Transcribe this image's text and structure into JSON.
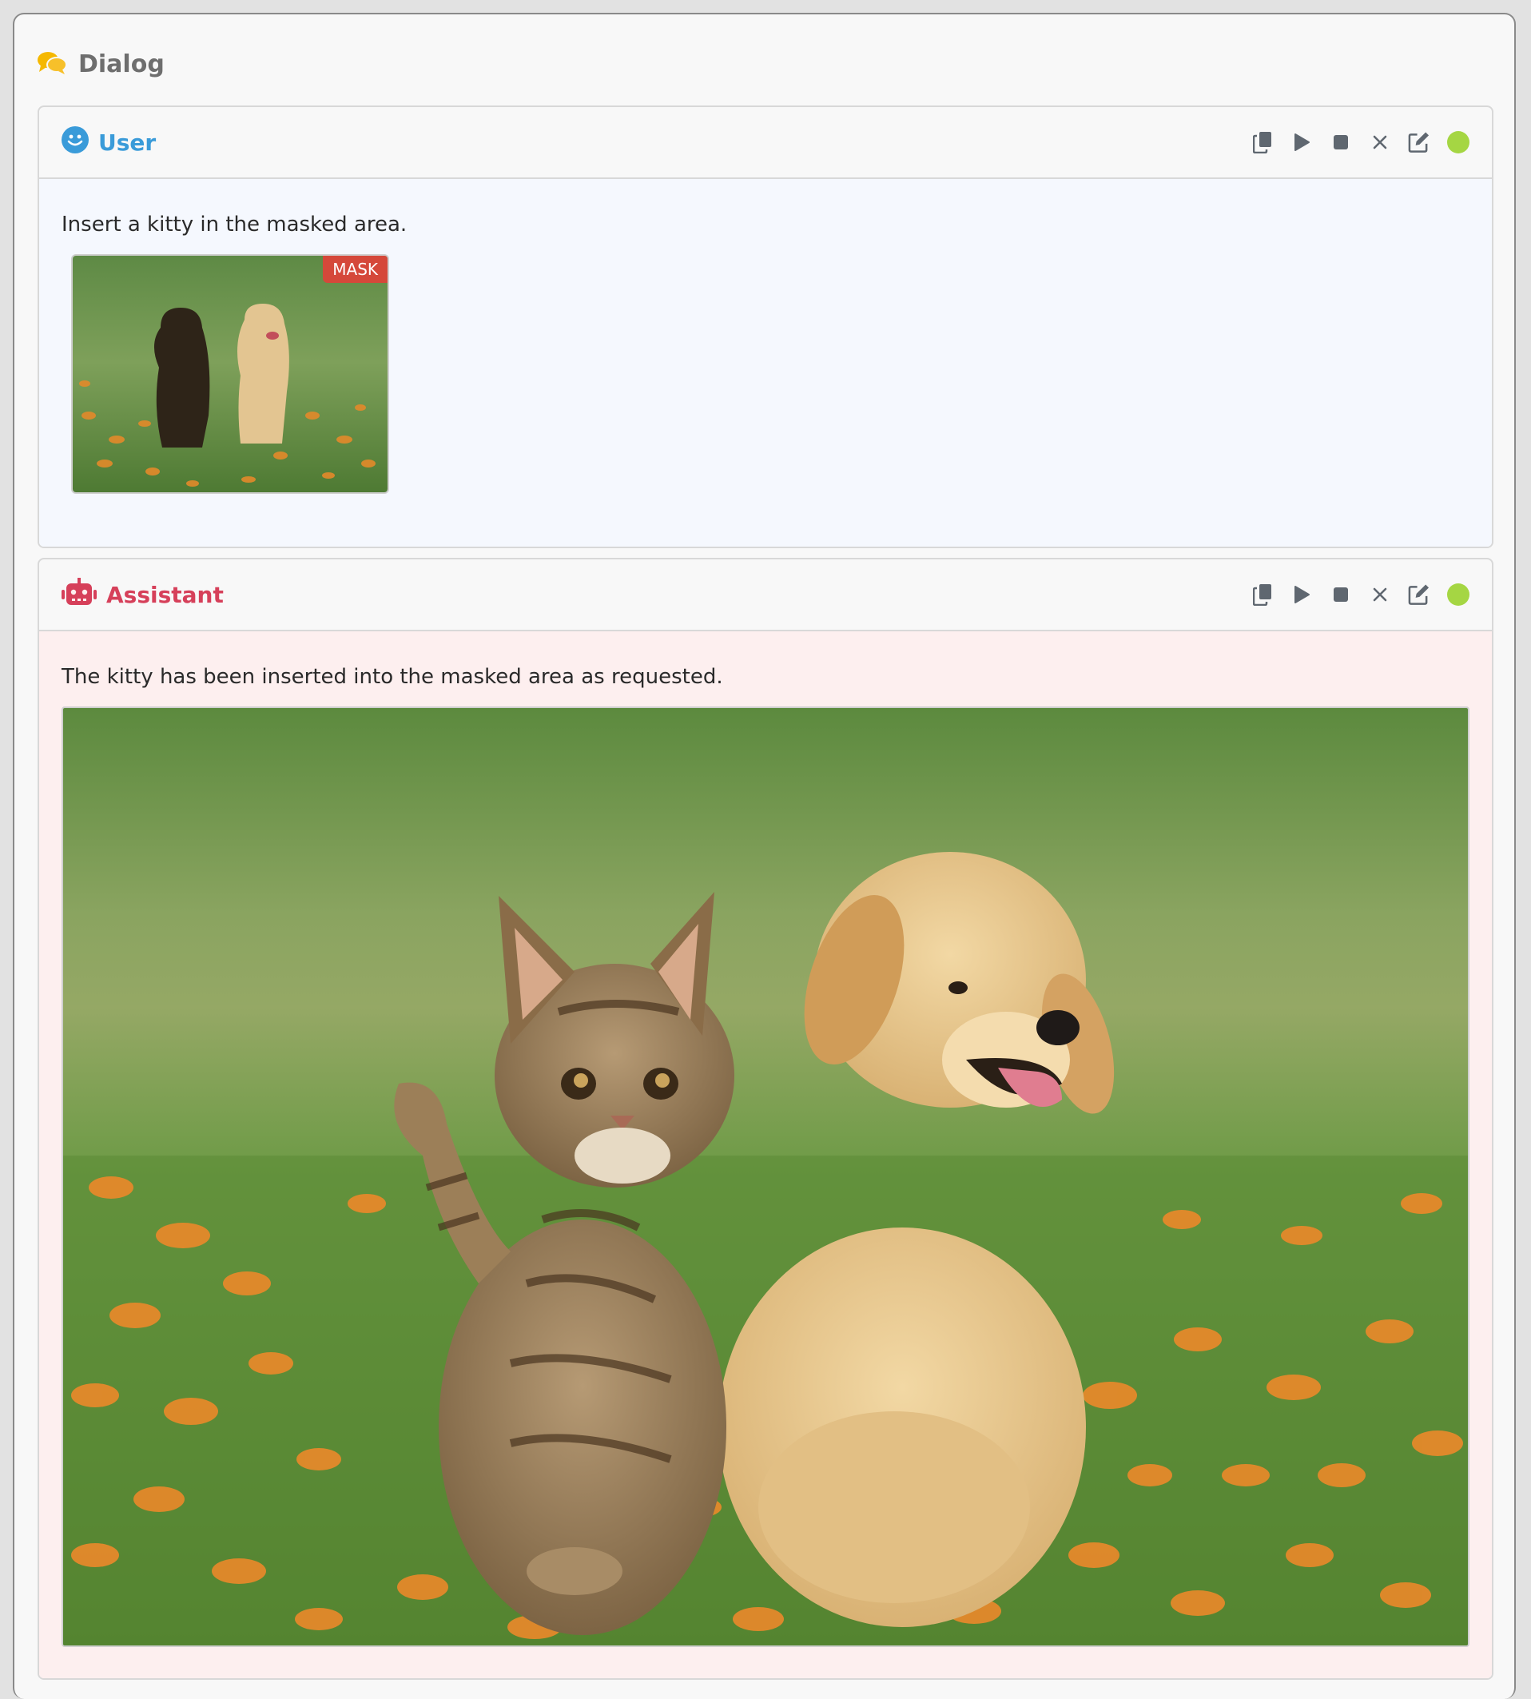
{
  "dialog": {
    "title": "Dialog",
    "icon": "comments-icon"
  },
  "messages": [
    {
      "role": "User",
      "role_color": "#3a9bd9",
      "icon": "smiley-icon",
      "bg": "#f5f8fe",
      "text": "Insert a kitty in the masked area.",
      "attachment": {
        "badge": "MASK"
      },
      "tools": [
        "copy-icon",
        "play-icon",
        "stop-icon",
        "close-icon",
        "edit-icon"
      ]
    },
    {
      "role": "Assistant",
      "role_color": "#d6405a",
      "icon": "robot-icon",
      "bg": "#fdefef",
      "text": "The kitty has been inserted into the masked area as requested.",
      "tools": [
        "copy-icon",
        "play-icon",
        "stop-icon",
        "close-icon",
        "edit-icon"
      ]
    }
  ],
  "colors": {
    "status_ok": "#a5d643",
    "mask_badge": "#d5483a",
    "tool_icon": "#5f6770"
  }
}
